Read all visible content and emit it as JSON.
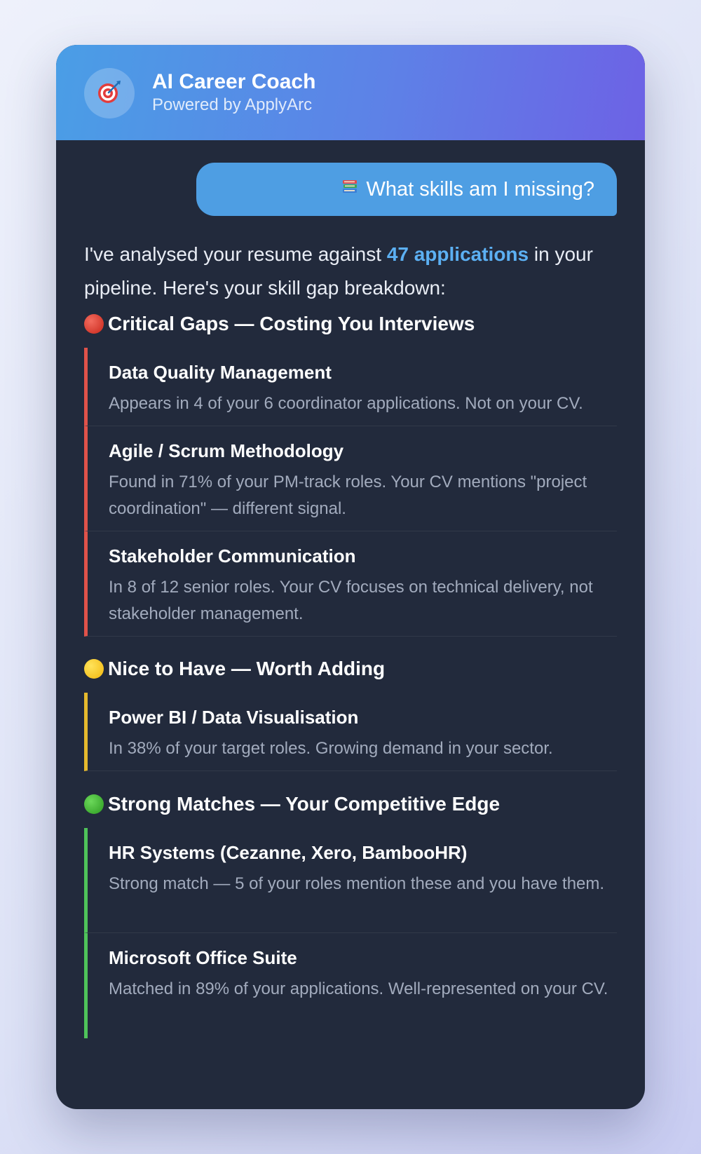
{
  "header": {
    "title": "AI Career Coach",
    "subtitle": "Powered by ApplyArc",
    "avatar_icon": "target-icon"
  },
  "chat": {
    "user_message": {
      "icon": "books-icon",
      "text": "What skills am I missing?"
    },
    "reply": {
      "intro_before": "I've analysed your resume against ",
      "intro_highlight": "47 applications",
      "intro_after": " in your pipeline. Here's your skill gap breakdown:",
      "sections": [
        {
          "title": "Critical Gaps — Costing You Interviews",
          "dot_color": "#d93025",
          "items": [
            {
              "title": "Data Quality Management",
              "desc": "Appears in 4 of your 6 coordinator applications. Not on your CV."
            },
            {
              "title": "Agile / Scrum Methodology",
              "desc": "Found in 71% of your PM-track roles. Your CV mentions \"project coordination\" — different signal."
            },
            {
              "title": "Stakeholder Communication",
              "desc": "In 8 of 12 senior roles. Your CV focuses on technical delivery, not stakeholder management."
            }
          ]
        },
        {
          "title": "Nice to Have — Worth Adding",
          "dot_color": "#f2c12e",
          "items": [
            {
              "title": "Power BI / Data Visualisation",
              "desc": "In 38% of your target roles. Growing demand in your sector."
            }
          ]
        },
        {
          "title": "Strong Matches — Your Competitive Edge",
          "dot_color": "#3aa935",
          "items": [
            {
              "title": "HR Systems (Cezanne, Xero, BambooHR)",
              "desc": "Strong match — 5 of your roles mention these and you have them."
            },
            {
              "title": "Microsoft Office Suite",
              "desc": "Matched in 89% of your applications. Well-represented on your CV."
            }
          ]
        }
      ]
    }
  },
  "colors": {
    "accent": "#5cb0f3",
    "critical": "#e0524a",
    "nice": "#e6b92d",
    "strong": "#4fc35a",
    "panel": "#222a3c"
  }
}
